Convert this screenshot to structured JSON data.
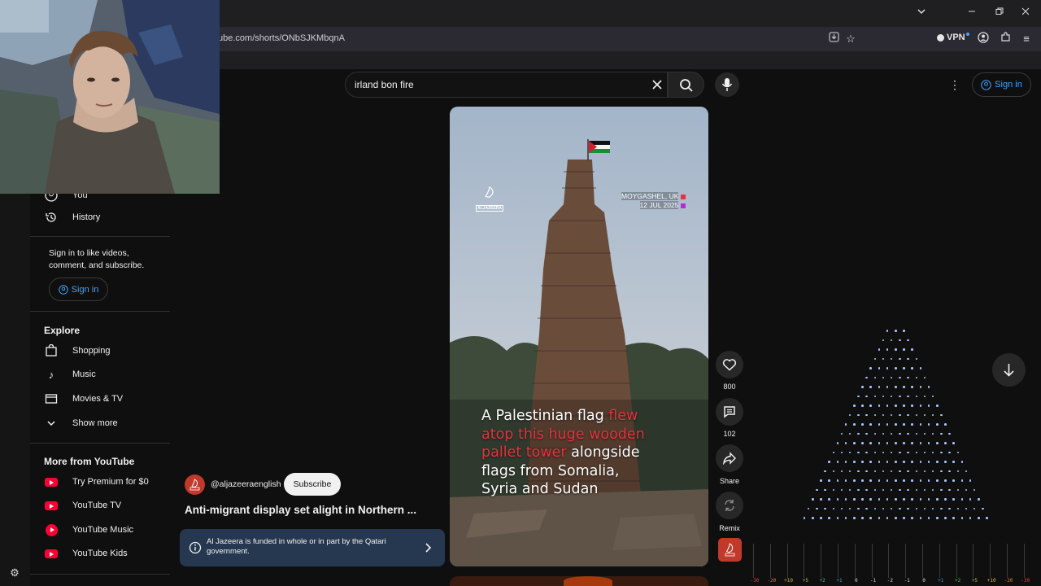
{
  "browser": {
    "url": "ube.com/shorts/ONbSJKMbqnA",
    "vpn_label": "VPN"
  },
  "sidebar": {
    "you_label": "You",
    "history_label": "History",
    "signin_prompt": "Sign in to like videos, comment, and subscribe.",
    "signin_button": "Sign in",
    "explore_heading": "Explore",
    "explore_items": [
      {
        "label": "Shopping",
        "icon": "shopping-bag-icon"
      },
      {
        "label": "Music",
        "icon": "music-note-icon"
      },
      {
        "label": "Movies & TV",
        "icon": "clapperboard-icon"
      },
      {
        "label": "Show more",
        "icon": "chevron-down-icon"
      }
    ],
    "more_heading": "More from YouTube",
    "more_items": [
      {
        "label": "Try Premium for $0",
        "icon": "youtube-premium-icon"
      },
      {
        "label": "YouTube TV",
        "icon": "youtube-tv-icon"
      },
      {
        "label": "YouTube Music",
        "icon": "youtube-music-icon"
      },
      {
        "label": "YouTube Kids",
        "icon": "youtube-kids-icon"
      }
    ]
  },
  "search": {
    "query": "irland bon fire"
  },
  "header": {
    "signin_label": "Sign in"
  },
  "video": {
    "watermark": "ALJAZEERA",
    "location": "MOYGASHEL, UK",
    "date": "12 JUL 2025",
    "caption_1_white": "A Palestinian flag ",
    "caption_1_red": "flew",
    "caption_2_red": "atop this huge wooden",
    "caption_3_red": "pallet tower",
    "caption_3_white": " alongside",
    "caption_4": "flags from Somalia,",
    "caption_5": "Syria and Sudan"
  },
  "channel": {
    "handle": "@aljazeeraenglish",
    "subscribe_label": "Subscribe",
    "title": "Anti-migrant display set alight in Northern ...",
    "funding_notice": "Al Jazeera is funded in whole or in part by the Qatari government."
  },
  "actions": {
    "likes": "800",
    "comments": "102",
    "share_label": "Share",
    "remix_label": "Remix"
  },
  "equalizer": {
    "labels": [
      "-30",
      "-20",
      "+10",
      "+5",
      "+2",
      "+1",
      "0",
      "-1",
      "-2",
      "-1",
      "0",
      "+1",
      "+2",
      "+5",
      "+10",
      "-20",
      "-30"
    ]
  },
  "colors": {
    "accent_link": "#3ea6ff",
    "caption_red": "#e2333f",
    "brand_red": "#ff0033"
  }
}
